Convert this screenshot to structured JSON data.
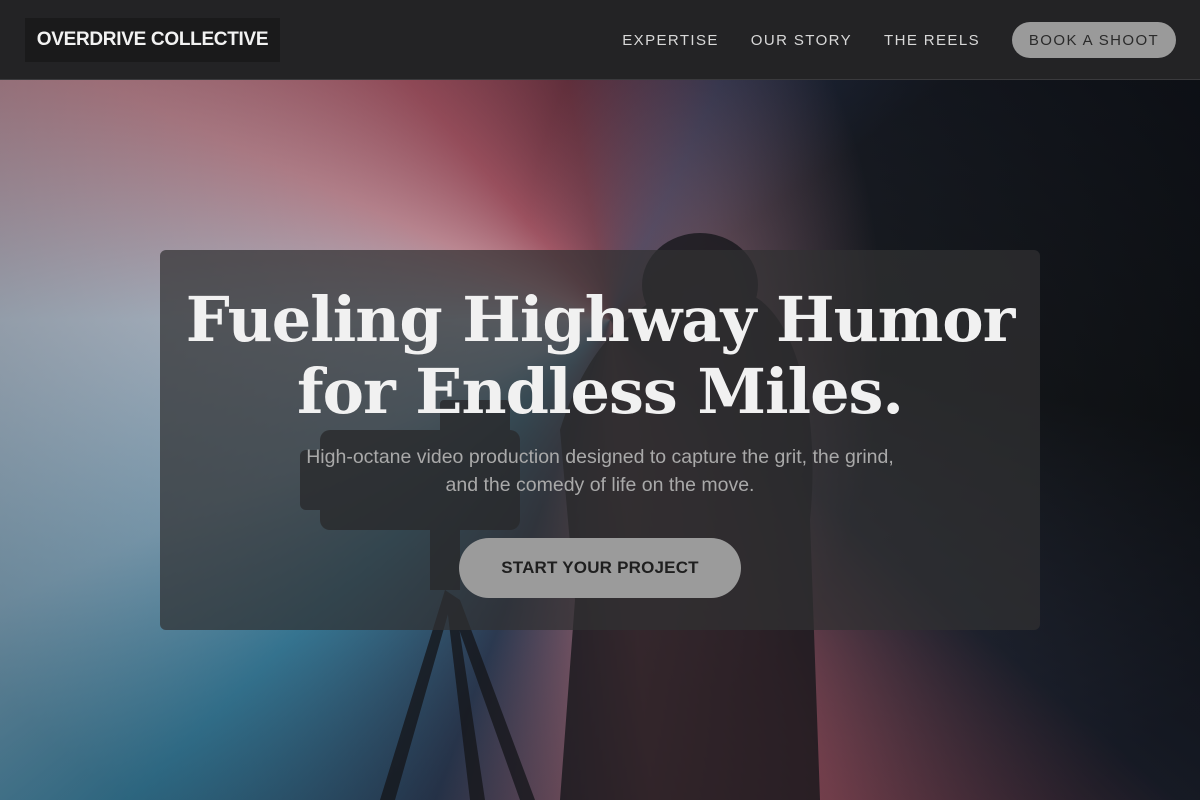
{
  "nav": {
    "logo": "OVERDRIVE COLLECTIVE",
    "links": [
      "EXPERTISE",
      "OUR STORY",
      "THE REELS"
    ],
    "cta": "BOOK A SHOOT"
  },
  "hero": {
    "title_line1": "Fueling Highway Humor",
    "title_line2": "for Endless Miles.",
    "subtitle_line1": "High-octane video production designed to capture the grit, the grind,",
    "subtitle_line2": "and the comedy of life on the move.",
    "cta": "START YOUR PROJECT"
  },
  "colors": {
    "nav_bg": "#232325",
    "button_bg": "#9b9b9b",
    "text_light": "#f1f1f1"
  }
}
